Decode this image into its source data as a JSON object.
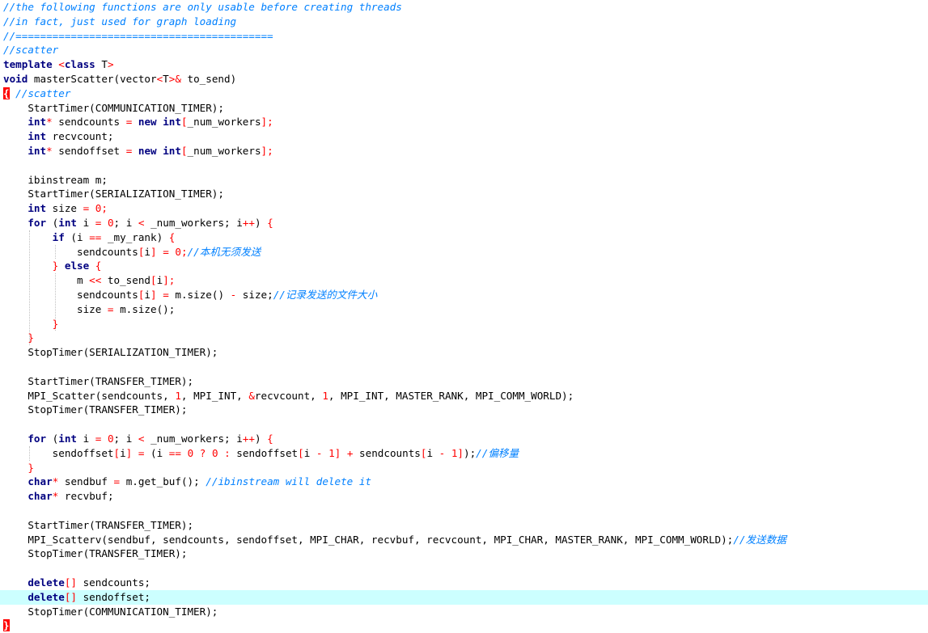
{
  "editor": {
    "current_line": 41,
    "colors": {
      "comment": "#0080ff",
      "keyword": "#000080",
      "operator": "#ff0000",
      "number": "#ff0000",
      "current_line_bg": "#ccffff",
      "brace_highlight": "#ff0000"
    },
    "lines": [
      [
        {
          "t": "//the following functions are only usable before creating threads",
          "c": "comment"
        }
      ],
      [
        {
          "t": "//in fact, just used for graph loading",
          "c": "comment"
        }
      ],
      [
        {
          "t": "//==========================================",
          "c": "comment"
        }
      ],
      [
        {
          "t": "//scatter",
          "c": "comment"
        }
      ],
      [
        {
          "t": "template ",
          "c": "keyword"
        },
        {
          "t": "<",
          "c": "operator"
        },
        {
          "t": "class ",
          "c": "keyword"
        },
        {
          "t": "T",
          "c": "ident"
        },
        {
          "t": ">",
          "c": "operator"
        }
      ],
      [
        {
          "t": "void ",
          "c": "keyword"
        },
        {
          "t": "masterScatter(vector",
          "c": "ident"
        },
        {
          "t": "<",
          "c": "operator"
        },
        {
          "t": "T",
          "c": "ident"
        },
        {
          "t": ">&",
          "c": "operator"
        },
        {
          "t": " to_send)",
          "c": "ident"
        }
      ],
      [
        {
          "t": "{",
          "c": "bracehl"
        },
        {
          "t": " //scatter",
          "c": "comment"
        }
      ],
      [
        {
          "t": "    StartTimer(COMMUNICATION_TIMER);",
          "c": "ident"
        }
      ],
      [
        {
          "t": "    ",
          "c": "ident"
        },
        {
          "t": "int",
          "c": "keyword"
        },
        {
          "t": "*",
          "c": "operator"
        },
        {
          "t": " sendcounts ",
          "c": "ident"
        },
        {
          "t": "=",
          "c": "operator"
        },
        {
          "t": " ",
          "c": "ident"
        },
        {
          "t": "new int",
          "c": "keyword"
        },
        {
          "t": "[",
          "c": "punct"
        },
        {
          "t": "_num_workers",
          "c": "ident"
        },
        {
          "t": "];",
          "c": "punct"
        }
      ],
      [
        {
          "t": "    ",
          "c": "ident"
        },
        {
          "t": "int",
          "c": "keyword"
        },
        {
          "t": " recvcount;",
          "c": "ident"
        }
      ],
      [
        {
          "t": "    ",
          "c": "ident"
        },
        {
          "t": "int",
          "c": "keyword"
        },
        {
          "t": "*",
          "c": "operator"
        },
        {
          "t": " sendoffset ",
          "c": "ident"
        },
        {
          "t": "=",
          "c": "operator"
        },
        {
          "t": " ",
          "c": "ident"
        },
        {
          "t": "new int",
          "c": "keyword"
        },
        {
          "t": "[",
          "c": "punct"
        },
        {
          "t": "_num_workers",
          "c": "ident"
        },
        {
          "t": "];",
          "c": "punct"
        }
      ],
      [],
      [
        {
          "t": "    ibinstream m;",
          "c": "ident"
        }
      ],
      [
        {
          "t": "    StartTimer(SERIALIZATION_TIMER);",
          "c": "ident"
        }
      ],
      [
        {
          "t": "    ",
          "c": "ident"
        },
        {
          "t": "int",
          "c": "keyword"
        },
        {
          "t": " size ",
          "c": "ident"
        },
        {
          "t": "=",
          "c": "operator"
        },
        {
          "t": " ",
          "c": "ident"
        },
        {
          "t": "0",
          "c": "number"
        },
        {
          "t": ";",
          "c": "punct"
        }
      ],
      [
        {
          "t": "    ",
          "c": "ident"
        },
        {
          "t": "for",
          "c": "keyword"
        },
        {
          "t": " (",
          "c": "ident"
        },
        {
          "t": "int",
          "c": "keyword"
        },
        {
          "t": " i ",
          "c": "ident"
        },
        {
          "t": "=",
          "c": "operator"
        },
        {
          "t": " ",
          "c": "ident"
        },
        {
          "t": "0",
          "c": "number"
        },
        {
          "t": "; i ",
          "c": "ident"
        },
        {
          "t": "<",
          "c": "operator"
        },
        {
          "t": " _num_workers; i",
          "c": "ident"
        },
        {
          "t": "++",
          "c": "operator"
        },
        {
          "t": ") ",
          "c": "ident"
        },
        {
          "t": "{",
          "c": "punct"
        }
      ],
      [
        {
          "t": "        ",
          "c": "ident"
        },
        {
          "t": "if",
          "c": "keyword"
        },
        {
          "t": " (i ",
          "c": "ident"
        },
        {
          "t": "==",
          "c": "operator"
        },
        {
          "t": " _my_rank) ",
          "c": "ident"
        },
        {
          "t": "{",
          "c": "punct"
        }
      ],
      [
        {
          "t": "            sendcounts",
          "c": "ident"
        },
        {
          "t": "[",
          "c": "punct"
        },
        {
          "t": "i",
          "c": "ident"
        },
        {
          "t": "]",
          "c": "punct"
        },
        {
          "t": " ",
          "c": "ident"
        },
        {
          "t": "=",
          "c": "operator"
        },
        {
          "t": " ",
          "c": "ident"
        },
        {
          "t": "0",
          "c": "number"
        },
        {
          "t": ";",
          "c": "punct"
        },
        {
          "t": "//本机无须发送",
          "c": "comment"
        }
      ],
      [
        {
          "t": "        ",
          "c": "ident"
        },
        {
          "t": "}",
          "c": "punct"
        },
        {
          "t": " ",
          "c": "ident"
        },
        {
          "t": "else",
          "c": "keyword"
        },
        {
          "t": " ",
          "c": "ident"
        },
        {
          "t": "{",
          "c": "punct"
        }
      ],
      [
        {
          "t": "            m ",
          "c": "ident"
        },
        {
          "t": "<<",
          "c": "operator"
        },
        {
          "t": " to_send",
          "c": "ident"
        },
        {
          "t": "[",
          "c": "punct"
        },
        {
          "t": "i",
          "c": "ident"
        },
        {
          "t": "];",
          "c": "punct"
        }
      ],
      [
        {
          "t": "            sendcounts",
          "c": "ident"
        },
        {
          "t": "[",
          "c": "punct"
        },
        {
          "t": "i",
          "c": "ident"
        },
        {
          "t": "]",
          "c": "punct"
        },
        {
          "t": " ",
          "c": "ident"
        },
        {
          "t": "=",
          "c": "operator"
        },
        {
          "t": " m.size() ",
          "c": "ident"
        },
        {
          "t": "-",
          "c": "operator"
        },
        {
          "t": " size;",
          "c": "ident"
        },
        {
          "t": "//记录发送的文件大小",
          "c": "comment"
        }
      ],
      [
        {
          "t": "            size ",
          "c": "ident"
        },
        {
          "t": "=",
          "c": "operator"
        },
        {
          "t": " m.size();",
          "c": "ident"
        }
      ],
      [
        {
          "t": "        ",
          "c": "ident"
        },
        {
          "t": "}",
          "c": "punct"
        }
      ],
      [
        {
          "t": "    ",
          "c": "ident"
        },
        {
          "t": "}",
          "c": "punct"
        }
      ],
      [
        {
          "t": "    StopTimer(SERIALIZATION_TIMER);",
          "c": "ident"
        }
      ],
      [],
      [
        {
          "t": "    StartTimer(TRANSFER_TIMER);",
          "c": "ident"
        }
      ],
      [
        {
          "t": "    MPI_Scatter(sendcounts, ",
          "c": "ident"
        },
        {
          "t": "1",
          "c": "number"
        },
        {
          "t": ", MPI_INT, ",
          "c": "ident"
        },
        {
          "t": "&",
          "c": "operator"
        },
        {
          "t": "recvcount, ",
          "c": "ident"
        },
        {
          "t": "1",
          "c": "number"
        },
        {
          "t": ", MPI_INT, MASTER_RANK, MPI_COMM_WORLD);",
          "c": "ident"
        }
      ],
      [
        {
          "t": "    StopTimer(TRANSFER_TIMER);",
          "c": "ident"
        }
      ],
      [],
      [
        {
          "t": "    ",
          "c": "ident"
        },
        {
          "t": "for",
          "c": "keyword"
        },
        {
          "t": " (",
          "c": "ident"
        },
        {
          "t": "int",
          "c": "keyword"
        },
        {
          "t": " i ",
          "c": "ident"
        },
        {
          "t": "=",
          "c": "operator"
        },
        {
          "t": " ",
          "c": "ident"
        },
        {
          "t": "0",
          "c": "number"
        },
        {
          "t": "; i ",
          "c": "ident"
        },
        {
          "t": "<",
          "c": "operator"
        },
        {
          "t": " _num_workers; i",
          "c": "ident"
        },
        {
          "t": "++",
          "c": "operator"
        },
        {
          "t": ") ",
          "c": "ident"
        },
        {
          "t": "{",
          "c": "punct"
        }
      ],
      [
        {
          "t": "        sendoffset",
          "c": "ident"
        },
        {
          "t": "[",
          "c": "punct"
        },
        {
          "t": "i",
          "c": "ident"
        },
        {
          "t": "]",
          "c": "punct"
        },
        {
          "t": " ",
          "c": "ident"
        },
        {
          "t": "=",
          "c": "operator"
        },
        {
          "t": " (i ",
          "c": "ident"
        },
        {
          "t": "==",
          "c": "operator"
        },
        {
          "t": " ",
          "c": "ident"
        },
        {
          "t": "0",
          "c": "number"
        },
        {
          "t": " ",
          "c": "ident"
        },
        {
          "t": "?",
          "c": "operator"
        },
        {
          "t": " ",
          "c": "ident"
        },
        {
          "t": "0",
          "c": "number"
        },
        {
          "t": " ",
          "c": "ident"
        },
        {
          "t": ":",
          "c": "operator"
        },
        {
          "t": " sendoffset",
          "c": "ident"
        },
        {
          "t": "[",
          "c": "punct"
        },
        {
          "t": "i ",
          "c": "ident"
        },
        {
          "t": "-",
          "c": "operator"
        },
        {
          "t": " ",
          "c": "ident"
        },
        {
          "t": "1",
          "c": "number"
        },
        {
          "t": "]",
          "c": "punct"
        },
        {
          "t": " ",
          "c": "ident"
        },
        {
          "t": "+",
          "c": "operator"
        },
        {
          "t": " sendcounts",
          "c": "ident"
        },
        {
          "t": "[",
          "c": "punct"
        },
        {
          "t": "i ",
          "c": "ident"
        },
        {
          "t": "-",
          "c": "operator"
        },
        {
          "t": " ",
          "c": "ident"
        },
        {
          "t": "1",
          "c": "number"
        },
        {
          "t": "]",
          "c": "punct"
        },
        {
          "t": ");",
          "c": "ident"
        },
        {
          "t": "//偏移量",
          "c": "comment"
        }
      ],
      [
        {
          "t": "    ",
          "c": "ident"
        },
        {
          "t": "}",
          "c": "punct"
        }
      ],
      [
        {
          "t": "    ",
          "c": "ident"
        },
        {
          "t": "char",
          "c": "keyword"
        },
        {
          "t": "*",
          "c": "operator"
        },
        {
          "t": " sendbuf ",
          "c": "ident"
        },
        {
          "t": "=",
          "c": "operator"
        },
        {
          "t": " m.get_buf(); ",
          "c": "ident"
        },
        {
          "t": "//ibinstream will delete it",
          "c": "comment"
        }
      ],
      [
        {
          "t": "    ",
          "c": "ident"
        },
        {
          "t": "char",
          "c": "keyword"
        },
        {
          "t": "*",
          "c": "operator"
        },
        {
          "t": " recvbuf;",
          "c": "ident"
        }
      ],
      [],
      [
        {
          "t": "    StartTimer(TRANSFER_TIMER);",
          "c": "ident"
        }
      ],
      [
        {
          "t": "    MPI_Scatterv(sendbuf, sendcounts, sendoffset, MPI_CHAR, recvbuf, recvcount, MPI_CHAR, MASTER_RANK, MPI_COMM_WORLD);",
          "c": "ident"
        },
        {
          "t": "//发送数据",
          "c": "comment"
        }
      ],
      [
        {
          "t": "    StopTimer(TRANSFER_TIMER);",
          "c": "ident"
        }
      ],
      [],
      [
        {
          "t": "    ",
          "c": "ident"
        },
        {
          "t": "delete",
          "c": "keyword"
        },
        {
          "t": "[]",
          "c": "punct"
        },
        {
          "t": " sendcounts;",
          "c": "ident"
        }
      ],
      [
        {
          "t": "    ",
          "c": "ident"
        },
        {
          "t": "delete",
          "c": "keyword"
        },
        {
          "t": "[]",
          "c": "punct"
        },
        {
          "t": " sendoffset;",
          "c": "ident"
        }
      ],
      [
        {
          "t": "    StopTimer(COMMUNICATION_TIMER);",
          "c": "ident"
        }
      ],
      [
        {
          "t": "}",
          "c": "bracehl"
        }
      ]
    ]
  }
}
